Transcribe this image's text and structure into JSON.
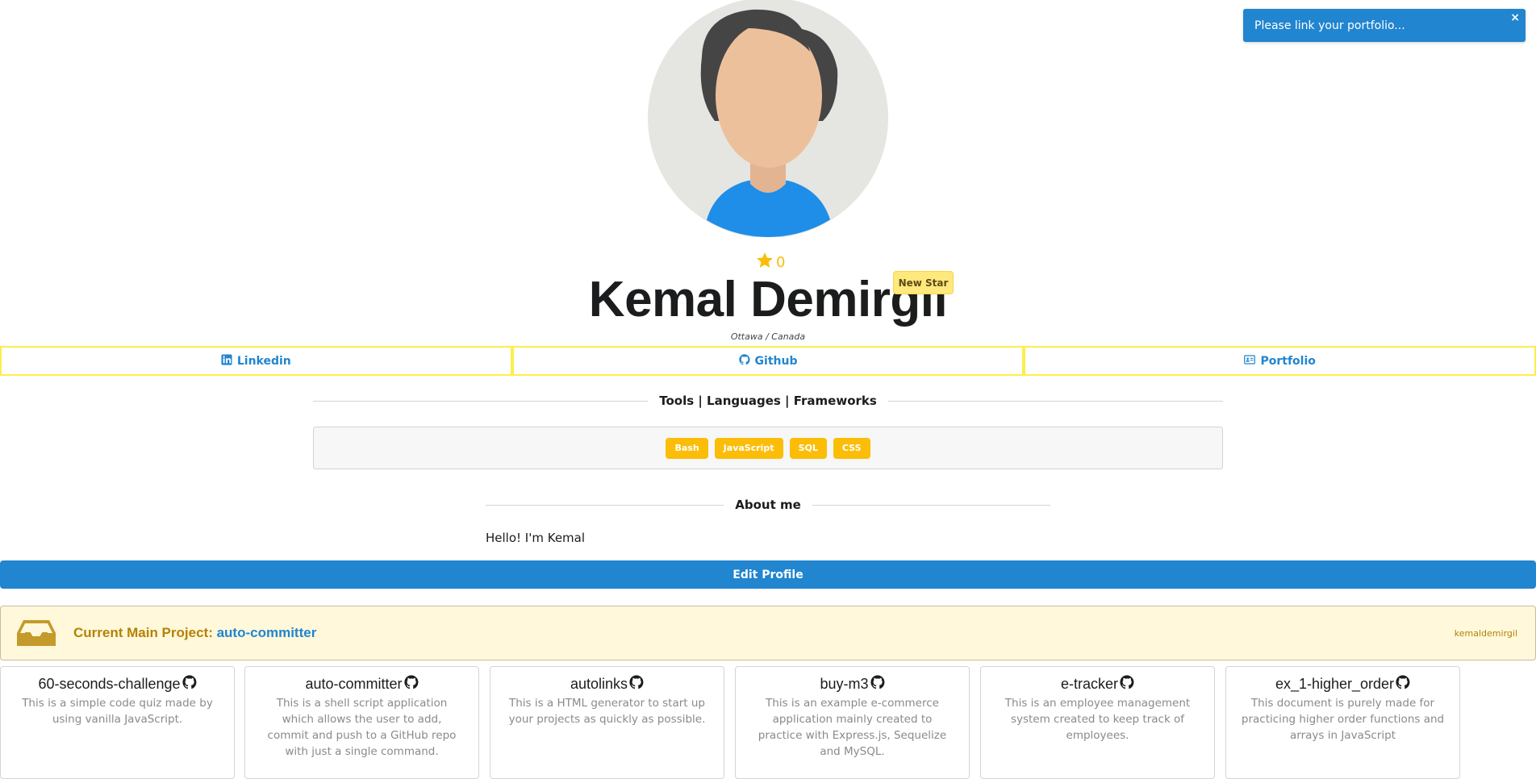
{
  "profile": {
    "star_count": "0",
    "name": "Kemal Demirgil",
    "new_star_label": "New Star",
    "location": "Ottawa / Canada"
  },
  "links": [
    {
      "label": "Linkedin",
      "icon": "linkedin-icon"
    },
    {
      "label": "Github",
      "icon": "github-icon"
    },
    {
      "label": "Portfolio",
      "icon": "id-card-icon"
    }
  ],
  "tools": {
    "heading": "Tools | Languages | Frameworks",
    "tags": [
      "Bash",
      "JavaScript",
      "SQL",
      "CSS"
    ]
  },
  "about": {
    "heading": "About me",
    "text": "Hello! I'm Kemal"
  },
  "edit_profile_label": "Edit Profile",
  "main_project": {
    "prefix": "Current Main Project: ",
    "name": "auto-committer",
    "username": "kemaldemirgil"
  },
  "projects": [
    {
      "title": "60-seconds-challenge",
      "description": "This is a simple code quiz made by using vanilla JavaScript."
    },
    {
      "title": "auto-committer",
      "description": "This is a shell script application which allows the user to add, commit and push to a GitHub repo with just a single command."
    },
    {
      "title": "autolinks",
      "description": "This is a HTML generator to start up your projects as quickly as possible."
    },
    {
      "title": "buy-m3",
      "description": "This is an example e-commerce application mainly created to practice with Express.js, Sequelize and MySQL."
    },
    {
      "title": "e-tracker",
      "description": "This is an employee management system created to keep track of employees."
    },
    {
      "title": "ex_1-higher_order",
      "description": "This document is purely made for practicing higher order functions and arrays in JavaScript"
    }
  ],
  "notification": {
    "text": "Please link your portfolio...",
    "close_label": "×"
  },
  "colors": {
    "primary": "#2185d0",
    "yellow": "#fbbd08",
    "link_border": "#fdee4a",
    "warning_bg": "#fff8db",
    "warning_text": "#b58105"
  }
}
